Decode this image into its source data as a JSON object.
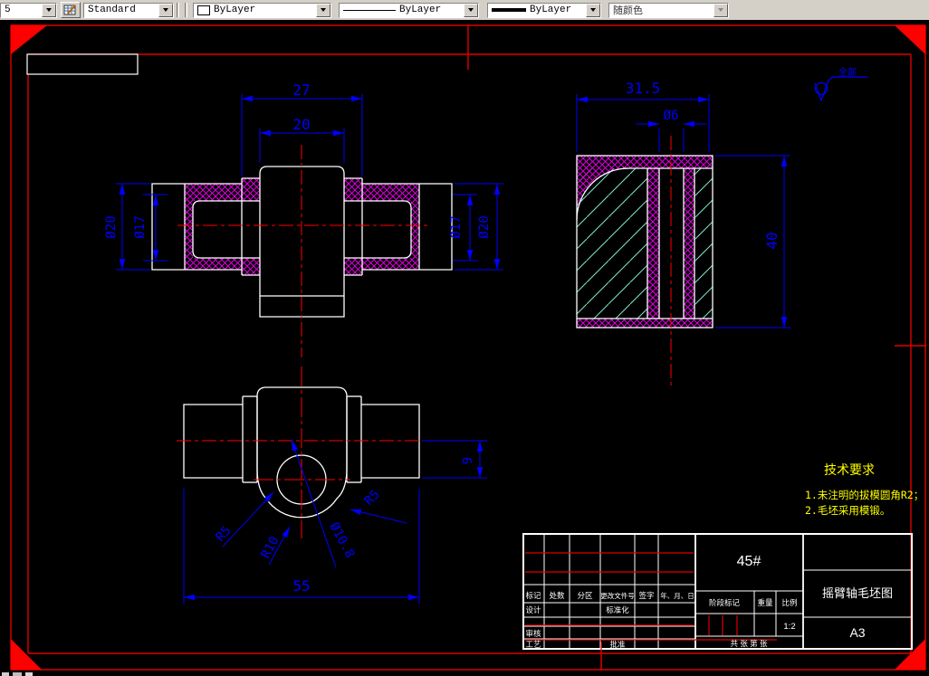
{
  "toolbar": {
    "partial_combo_value": "5",
    "text_style_combo": "Standard",
    "color_combo": "ByLayer",
    "linetype_combo": "ByLayer",
    "lineweight_combo": "ByLayer",
    "plotstyle_combo": "随颜色"
  },
  "colors": {
    "dimension_blue": "#0000ff",
    "geometry_white": "#ffffff",
    "centerline_red": "#ff0000",
    "frame_red": "#dd0000",
    "hatch_magenta": "#e000e0",
    "hatch_cyan": "#7fe9c8",
    "annotation_yellow": "#ffff00",
    "toolbar_gray": "#d4d0c8"
  },
  "dimensions": {
    "front_view": {
      "width_outer": "27",
      "width_boss": "20",
      "dia_outer": "Ø20",
      "dia_inner": "Ø17"
    },
    "side_view": {
      "width": "31.5",
      "hole_dia": "Ø6",
      "height": "40"
    },
    "top_view": {
      "offset": "9",
      "length": "55",
      "fillet_small": "R5",
      "fillet_mid": "R10",
      "boss_hole_dia": "Ø10.8"
    }
  },
  "annotations": {
    "surface_note": "全部",
    "tech_requirements": {
      "title": "技术要求",
      "line1": "1.未注明的拔模圆角R2；",
      "line2": "2.毛坯采用模锻。"
    }
  },
  "title_block": {
    "material": "45#",
    "drawing_title": "摇臂轴毛坯图",
    "paper_size": "A3",
    "scale_value": "1:2",
    "change_header": [
      "标记",
      "处数",
      "分区",
      "更改文件号",
      "签字",
      "年、月、日"
    ],
    "labels": {
      "design": "设计",
      "standardization": "标准化",
      "check": "审核",
      "process": "工艺",
      "approve": "批准",
      "stage_mark": "阶段标记",
      "weight": "重量",
      "scale": "比例",
      "sheet_info": "共  张  第  张"
    }
  }
}
